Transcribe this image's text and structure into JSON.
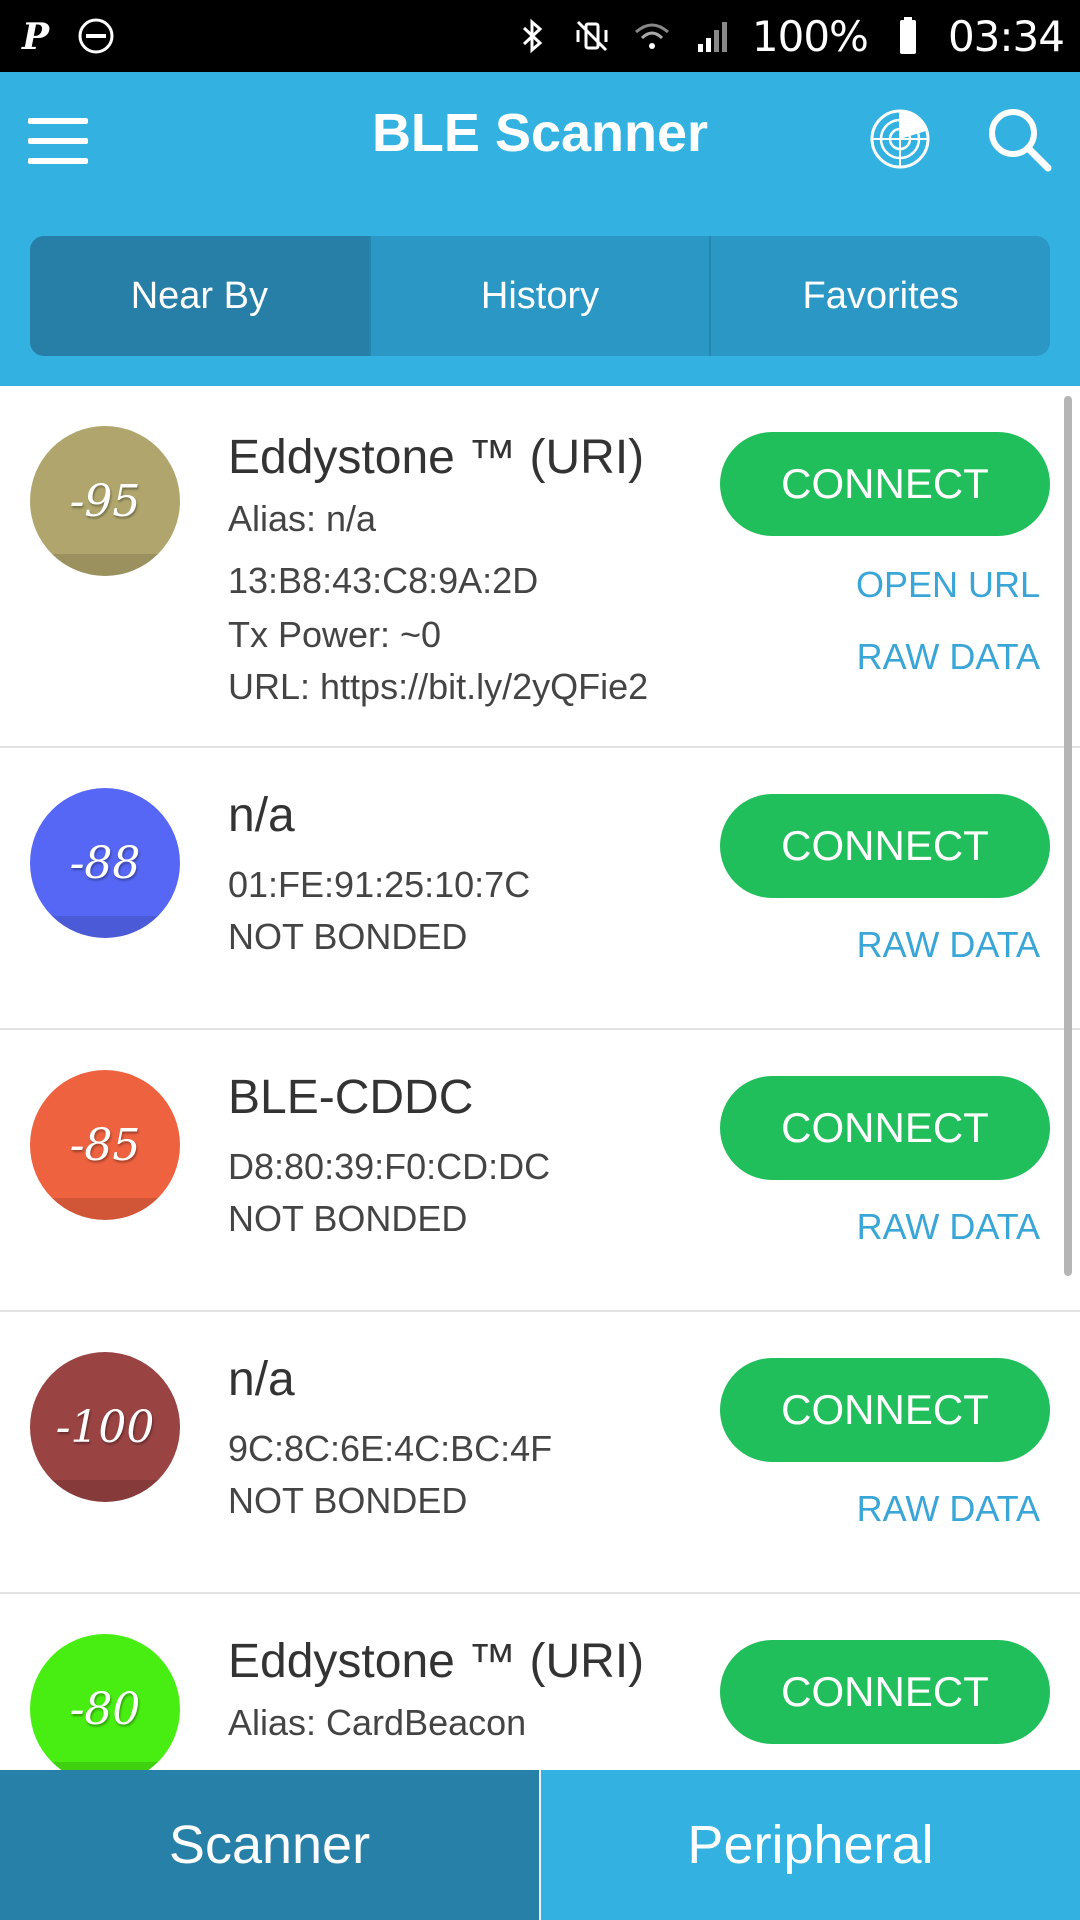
{
  "status_bar": {
    "battery": "100%",
    "time": "03:34"
  },
  "app_bar": {
    "title": "BLE Scanner",
    "tabs": [
      {
        "label": "Near By"
      },
      {
        "label": "History"
      },
      {
        "label": "Favorites"
      }
    ]
  },
  "devices": [
    {
      "rssi": "-95",
      "color": "#b0a66d",
      "name": "Eddystone ™ (URI)",
      "lines": [
        "Alias: n/a",
        "13:B8:43:C8:9A:2D",
        "Tx Power: ~0",
        "URL: https://bit.ly/2yQFie2"
      ],
      "connect_label": "CONNECT",
      "open_url_label": "OPEN URL",
      "raw_data_label": "RAW DATA"
    },
    {
      "rssi": "-88",
      "color": "#5667f5",
      "name": "n/a",
      "lines": [
        "01:FE:91:25:10:7C",
        "NOT BONDED"
      ],
      "connect_label": "CONNECT",
      "raw_data_label": "RAW DATA"
    },
    {
      "rssi": "-85",
      "color": "#ee6240",
      "name": "BLE-CDDC",
      "lines": [
        "D8:80:39:F0:CD:DC",
        "NOT BONDED"
      ],
      "connect_label": "CONNECT",
      "raw_data_label": "RAW DATA"
    },
    {
      "rssi": "-100",
      "color": "#9a4343",
      "name": "n/a",
      "lines": [
        "9C:8C:6E:4C:BC:4F",
        "NOT BONDED"
      ],
      "connect_label": "CONNECT",
      "raw_data_label": "RAW DATA"
    },
    {
      "rssi": "-80",
      "color": "#48ee12",
      "name": "Eddystone ™ (URI)",
      "lines": [
        "Alias: CardBeacon"
      ],
      "connect_label": "CONNECT"
    }
  ],
  "bottom_tabs": [
    {
      "label": "Scanner"
    },
    {
      "label": "Peripheral"
    }
  ],
  "colors": {
    "primary": "#33b2e1",
    "connect": "#21bf5b",
    "link": "#3aa6d8"
  }
}
